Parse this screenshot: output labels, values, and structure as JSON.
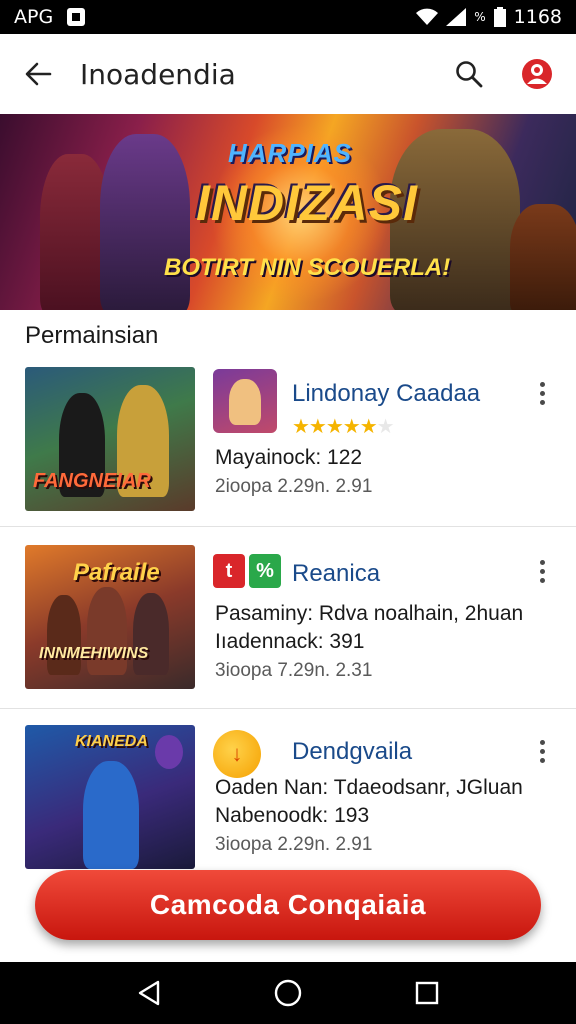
{
  "status_bar": {
    "carrier": "APG",
    "network_label": "%",
    "time": "1168"
  },
  "app_bar": {
    "title": "Inoadendia",
    "back_icon": "arrow-back-icon",
    "search_icon": "search-icon",
    "profile_icon": "avatar-icon",
    "profile_color": "#d9262a"
  },
  "banner": {
    "title_top": "HARPIAS",
    "title": "INDIZASI",
    "tagline": "BOTIRT NIN SCOUERLA!"
  },
  "section": {
    "title": "Permainsian"
  },
  "games": [
    {
      "thumb_text": "FANGNEIAR",
      "name": "Lindonay Caadaa",
      "rating_stars": 5,
      "rating_max": 6,
      "line1": "Mayainock: 122",
      "line2": "2ioopa 2.29n. 2.91"
    },
    {
      "thumb_title": "Pafraile",
      "thumb_text": "INNMEHIWINS",
      "icon_tile_1": "t",
      "icon_tile_2": "%",
      "name": "Reanica",
      "line1": "Pasaminy: Rdva noalhain, 2huan",
      "line2": "Iıadennack: 391",
      "line3": "3ioopa 7.29n. 2.31"
    },
    {
      "thumb_title": "KIANEDA",
      "icon_glyph": "↓",
      "name": "Dendgvaila",
      "line1": "Oaden Nan: Tdaeodsanr, JGluan",
      "line2": "Nabenoodk: 193",
      "line3": "3ioopa 2.29n. 2.91"
    }
  ],
  "cta": {
    "label": "Camcoda Conqaiaia",
    "color": "#d9262a"
  },
  "nav_bar": {
    "back_icon": "nav-back-icon",
    "home_icon": "nav-home-icon",
    "recents_icon": "nav-recents-icon"
  }
}
